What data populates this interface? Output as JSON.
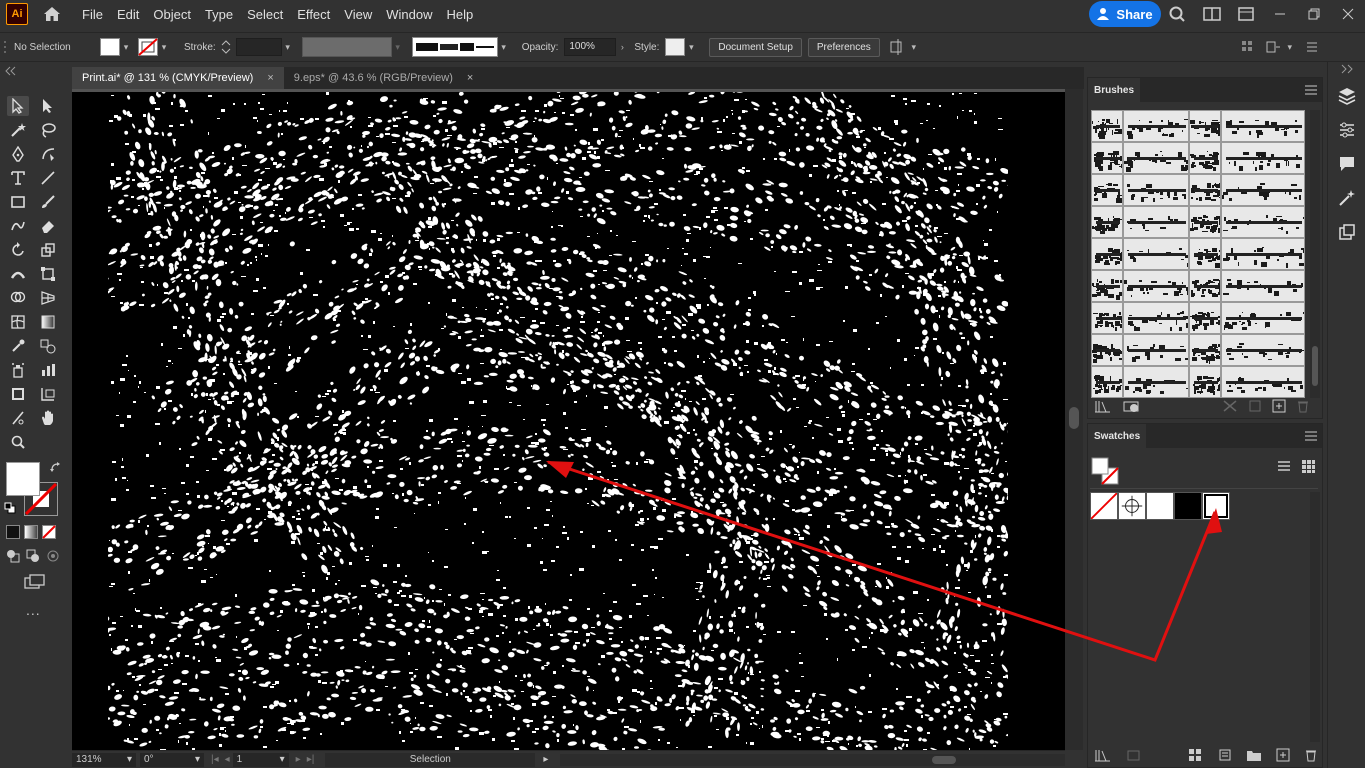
{
  "app": {
    "logo_text": "Ai"
  },
  "menu": [
    "File",
    "Edit",
    "Object",
    "Type",
    "Select",
    "Effect",
    "View",
    "Window",
    "Help"
  ],
  "share_label": "Share",
  "control_bar": {
    "selection_status": "No Selection",
    "stroke_label": "Stroke:",
    "opacity_label": "Opacity:",
    "opacity_value": "100%",
    "style_label": "Style:",
    "document_setup": "Document Setup",
    "preferences": "Preferences"
  },
  "tabs": [
    {
      "label": "Print.ai* @ 131 % (CMYK/Preview)",
      "active": true
    },
    {
      "label": "9.eps* @ 43.6 % (RGB/Preview)",
      "active": false
    }
  ],
  "tab_close_glyph": "×",
  "status_bar": {
    "zoom": "131%",
    "rotation": "0°",
    "artboard": "1",
    "tool": "Selection"
  },
  "panels": {
    "brushes": {
      "title": "Brushes"
    },
    "swatches": {
      "title": "Swatches"
    }
  },
  "swatches": [
    {
      "name": "none",
      "color": "#ffffff"
    },
    {
      "name": "registration",
      "color": "#ffffff"
    },
    {
      "name": "white",
      "color": "#ffffff"
    },
    {
      "name": "black",
      "color": "#000000"
    },
    {
      "name": "white",
      "color": "#ffffff"
    }
  ],
  "colors": {
    "accent": "#1473e6",
    "annotation": "#e01010"
  },
  "toolbar_more": "..."
}
